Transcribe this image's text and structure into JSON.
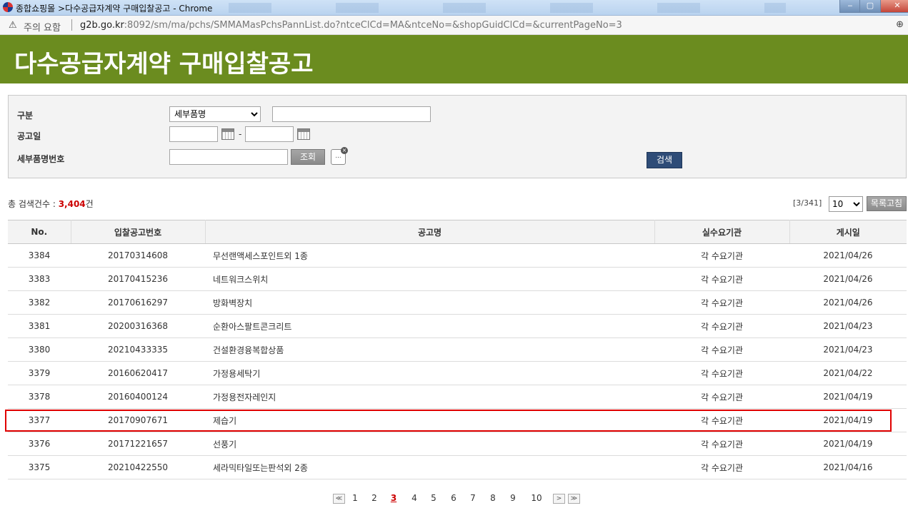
{
  "window": {
    "title": "종합쇼핑몰 >다수공급자계약 구매입찰공고 - Chrome",
    "min_label": "‒",
    "max_label": "▢",
    "close_label": "✕"
  },
  "address_bar": {
    "warning_icon": "⚠",
    "warning_text": "주의 요함",
    "host": "g2b.go.kr",
    "path": ":8092/sm/ma/pchs/SMMAMasPchsPannList.do?ntceClCd=MA&ntceNo=&shopGuidClCd=&currentPageNo=3",
    "zoom_icon": "⊕"
  },
  "page": {
    "heading": "다수공급자계약 구매입찰공고"
  },
  "search": {
    "category_label": "구분",
    "category_selected": "세부품명",
    "category_value": "",
    "date_label": "공고일",
    "date_from": "",
    "date_to": "",
    "date_separator": "-",
    "item_no_label": "세부품명번호",
    "item_no_value": "",
    "inquiry_button": "조회",
    "clear_button_text": "...",
    "search_button": "검색"
  },
  "results": {
    "total_label": "총 검색건수 : ",
    "total_count": "3,404",
    "total_unit": "건",
    "page_info": "[3/341]",
    "page_size": "10",
    "refresh_button": "목록고침"
  },
  "table": {
    "headers": [
      "No.",
      "입찰공고번호",
      "공고명",
      "실수요기관",
      "게시일"
    ],
    "rows": [
      {
        "no": "3384",
        "ntce_no": "20170314608",
        "name": "무선랜액세스포인트외 1종",
        "agency": "각 수요기관",
        "date": "2021/04/26"
      },
      {
        "no": "3383",
        "ntce_no": "20170415236",
        "name": "네트워크스위치",
        "agency": "각 수요기관",
        "date": "2021/04/26"
      },
      {
        "no": "3382",
        "ntce_no": "20170616297",
        "name": "방화벽장치",
        "agency": "각 수요기관",
        "date": "2021/04/26"
      },
      {
        "no": "3381",
        "ntce_no": "20200316368",
        "name": "순환아스팔트콘크리트",
        "agency": "각 수요기관",
        "date": "2021/04/23"
      },
      {
        "no": "3380",
        "ntce_no": "20210433335",
        "name": "건설환경융복합상품",
        "agency": "각 수요기관",
        "date": "2021/04/23"
      },
      {
        "no": "3379",
        "ntce_no": "20160620417",
        "name": "가정용세탁기",
        "agency": "각 수요기관",
        "date": "2021/04/22"
      },
      {
        "no": "3378",
        "ntce_no": "20160400124",
        "name": "가정용전자레인지",
        "agency": "각 수요기관",
        "date": "2021/04/19"
      },
      {
        "no": "3377",
        "ntce_no": "20170907671",
        "name": "제습기",
        "agency": "각 수요기관",
        "date": "2021/04/19"
      },
      {
        "no": "3376",
        "ntce_no": "20171221657",
        "name": "선풍기",
        "agency": "각 수요기관",
        "date": "2021/04/19"
      },
      {
        "no": "3375",
        "ntce_no": "20210422550",
        "name": "세라믹타일또는판석외 2종",
        "agency": "각 수요기관",
        "date": "2021/04/16"
      }
    ]
  },
  "pagination": {
    "first_icon": "≪",
    "pages": [
      "1",
      "2",
      "3",
      "4",
      "5",
      "6",
      "7",
      "8",
      "9",
      "10"
    ],
    "current": "3",
    "next_icon": ">",
    "last_icon": "≫"
  },
  "colors": {
    "banner": "#6b8c1f",
    "search_button": "#2e4c77",
    "highlight": "#e00000",
    "count": "#cc0000"
  }
}
